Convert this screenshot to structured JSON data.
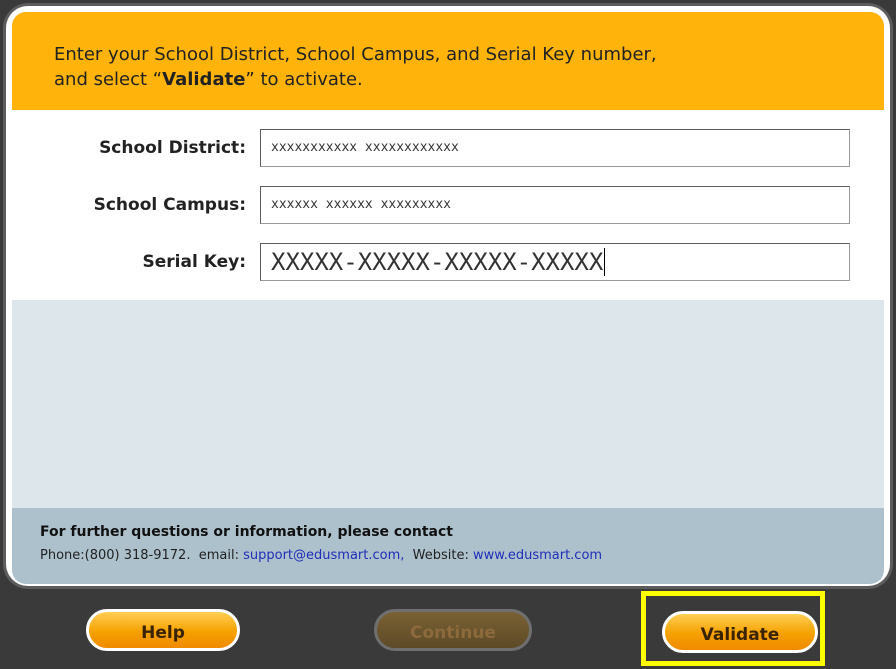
{
  "header": {
    "line1": "Enter your School District, School Campus, and Serial Key number,",
    "line2_pre": "and select “",
    "line2_bold": "Validate",
    "line2_post": "” to activate."
  },
  "form": {
    "district_label": "School District:",
    "district_value": "xxxxxxxxxxx xxxxxxxxxxxx",
    "campus_label": "School Campus:",
    "campus_value": "xxxxxx xxxxxx xxxxxxxxx",
    "serial_label": "Serial Key:",
    "serial_value": "XXXXX-XXXXX-XXXXX-XXXXX"
  },
  "footer": {
    "title": "For further questions or information, please contact",
    "phone_label": "Phone:",
    "phone": "(800) 318-9172.",
    "email_label": "email:",
    "email": "support@edusmart.com,",
    "website_label": "Website:",
    "website": "www.edusmart.com"
  },
  "buttons": {
    "help": "Help",
    "continue": "Continue",
    "validate": "Validate"
  },
  "colors": {
    "header_bg": "#ffb30b",
    "highlight": "#ffff00",
    "link": "#1f2fb8"
  }
}
